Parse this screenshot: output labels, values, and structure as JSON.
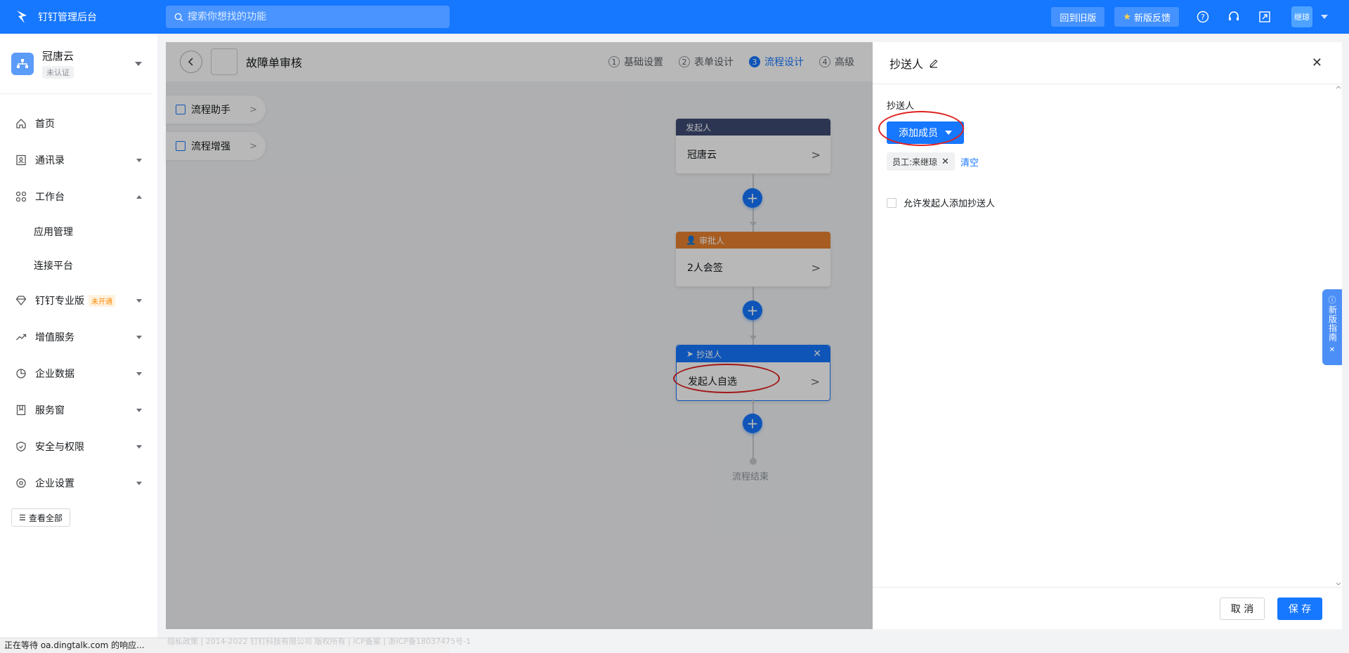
{
  "topbar": {
    "title": "钉钉管理后台",
    "search_placeholder": "搜索你想找的功能",
    "back_old": "回到旧版",
    "feedback": "新版反馈",
    "user": "继琼"
  },
  "sidebar": {
    "org_name": "冠唐云",
    "org_status": "未认证",
    "items": [
      {
        "label": "首页",
        "icon": "home-icon"
      },
      {
        "label": "通讯录",
        "icon": "contacts-icon"
      },
      {
        "label": "工作台",
        "icon": "apps-icon"
      },
      {
        "label": "应用管理"
      },
      {
        "label": "连接平台"
      },
      {
        "label": "钉钉专业版",
        "icon": "diamond-icon",
        "badge": "未开通"
      },
      {
        "label": "增值服务",
        "icon": "trend-icon"
      },
      {
        "label": "企业数据",
        "icon": "chart-icon"
      },
      {
        "label": "服务窗",
        "icon": "bookmark-icon"
      },
      {
        "label": "安全与权限",
        "icon": "shield-icon"
      },
      {
        "label": "企业设置",
        "icon": "settings-icon"
      }
    ],
    "view_all": "查看全部",
    "status_text": "正在等待 oa.dingtalk.com 的响应..."
  },
  "designer": {
    "form_title": "故障单审核",
    "steps": [
      {
        "num": "1",
        "label": "基础设置"
      },
      {
        "num": "2",
        "label": "表单设计"
      },
      {
        "num": "3",
        "label": "流程设计"
      },
      {
        "num": "4",
        "label": "高级"
      }
    ],
    "helpers": [
      "流程助手",
      "流程增强"
    ],
    "nodes": [
      {
        "head": "发起人",
        "body": "冠唐云",
        "color": "#3d4a72"
      },
      {
        "head": "审批人",
        "body": "2人会签",
        "color": "#e8822f"
      },
      {
        "head": "抄送人",
        "body": "发起人自选",
        "color": "#1677ff"
      }
    ],
    "end_label": "流程结束",
    "footer": "隐私政策 | 2014-2022 钉钉科技有限公司 版权所有 | ICP备案 | 浙ICP备18037475号-1"
  },
  "drawer": {
    "title": "抄送人",
    "field_label": "抄送人",
    "add_member": "添加成员",
    "tag": "员工:来继琼",
    "clear": "清空",
    "checkbox_label": "允许发起人添加抄送人",
    "cancel": "取 消",
    "save": "保 存"
  },
  "guide": {
    "label": "新版指南"
  },
  "colors": {
    "accent": "#1677ff",
    "annotation": "#e02020"
  }
}
